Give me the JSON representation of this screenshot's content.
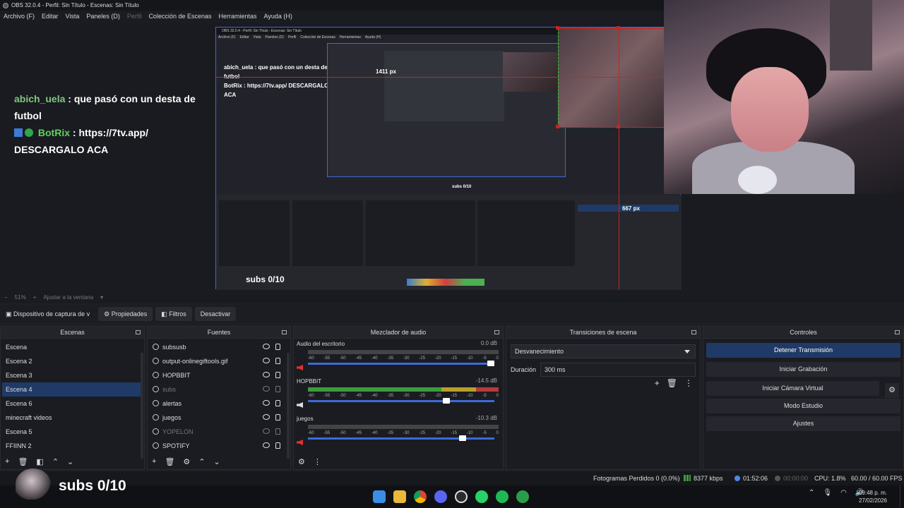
{
  "window": {
    "title": "OBS 32.0.4 - Perfil: Sin Título - Escenas: Sin Título"
  },
  "menu": [
    "Archivo (F)",
    "Editar",
    "Vista",
    "Paneles (D)",
    "Perfil",
    "Colección de Escenas",
    "Herramientas",
    "Ayuda (H)"
  ],
  "chat": {
    "msg1_user": "abich_uela",
    "msg1_text": ": que pasó con un desta de futbol",
    "msg2_user": "BotRix",
    "msg2_text": ": https://7tv.app/ DESCARGALO ACA"
  },
  "nested": {
    "title": "OBS 32.0.4 - Perfil: Sin Título - Escenas: Sin Título",
    "menu": [
      "Archivo (F)",
      "Editar",
      "Vista",
      "Paneles (D)",
      "Perfil",
      "Colección de Escenas",
      "Herramientas",
      "Ayuda (H)"
    ],
    "chat1": "abich_uela : que pasó con un desta de futbol",
    "chat2": "BotRix : https://7tv.app/ DESCARGALO ACA",
    "px_width": "1411 px",
    "px_height": "667 px",
    "subs_mini": "subs 0/10",
    "subs": "subs 0/10"
  },
  "zoom": {
    "level": "51%",
    "fit": "Ajustar a la ventana"
  },
  "source_toolbar": {
    "source_name": "Dispositivo de captura de v",
    "properties": "Propiedades",
    "filters": "Filtros",
    "deactivate": "Desactivar"
  },
  "docks": {
    "scenes_title": "Escenas",
    "sources_title": "Fuentes",
    "mixer_title": "Mezclador de audio",
    "transitions_title": "Transiciones de escena",
    "controls_title": "Controles"
  },
  "scenes": [
    "Escena",
    "Escena 2",
    "Escena 3",
    "Escena 4",
    "Escena 6",
    "minecraft videos",
    "Escena 5",
    "FFIINN 2"
  ],
  "selected_scene": "Escena 4",
  "sources": [
    {
      "name": "subsusb",
      "visible": true
    },
    {
      "name": "output-onlinegiftools.gif",
      "visible": true
    },
    {
      "name": "HOPBBIT",
      "visible": true
    },
    {
      "name": "subs",
      "visible": false
    },
    {
      "name": "alertas",
      "visible": true
    },
    {
      "name": "juegos",
      "visible": true
    },
    {
      "name": "YOPELON",
      "visible": false
    },
    {
      "name": "SPOTIFY",
      "visible": true
    }
  ],
  "mixer": {
    "scale": [
      "-60",
      "-55",
      "-50",
      "-45",
      "-40",
      "-35",
      "-30",
      "-25",
      "-20",
      "-15",
      "-10",
      "-5",
      "0"
    ],
    "channels": [
      {
        "name": "Audio del escritorio",
        "db": "0.0 dB",
        "muted": true,
        "level": 0,
        "volume": 100
      },
      {
        "name": "HOPBBIT",
        "db": "-14.5 dB",
        "muted": false,
        "level": 100,
        "volume": 76
      },
      {
        "name": "juegos",
        "db": "-10.3 dB",
        "muted": true,
        "level": 0,
        "volume": 85
      }
    ]
  },
  "transitions": {
    "type": "Desvanecimiento",
    "duration_label": "Duración",
    "duration": "300 ms"
  },
  "controls": {
    "stop_stream": "Detener Transmisión",
    "start_record": "Iniciar Grabación",
    "start_virtualcam": "Iniciar Cámara Virtual",
    "studio_mode": "Modo Estudio",
    "settings": "Ajustes"
  },
  "status": {
    "dropped": "Fotogramas Perdidos 0 (0.0%)",
    "bitrate": "8377 kbps",
    "stream_time": "01:52:06",
    "record_time": "00:00:00",
    "cpu": "CPU: 1.8%",
    "fps": "60.00 / 60.00 FPS"
  },
  "overlay": {
    "subs": "subs 0/10"
  },
  "taskbar": {
    "time": "09:48 p. m.",
    "date": "27/02/2026"
  },
  "colors": {
    "accent": "#1f3a66",
    "guide": "#d02020",
    "meter_green": "#3c9c3c"
  }
}
